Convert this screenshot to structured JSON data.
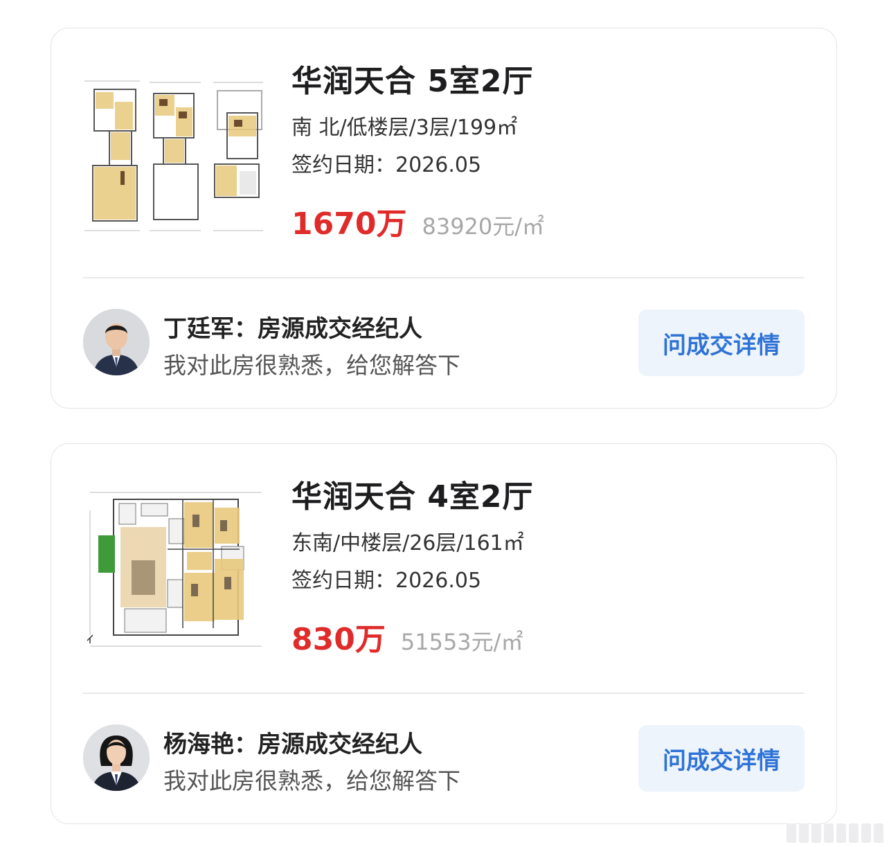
{
  "listings": [
    {
      "title": "华润天合 5室2厅",
      "meta": "南 北/低楼层/3层/199㎡",
      "sign_date": "签约日期：2026.05",
      "price": "1670万",
      "unit_price": "83920元/㎡",
      "agent": {
        "name": "丁廷军：房源成交经纪人",
        "desc": "我对此房很熟悉，给您解答下",
        "button": "问成交详情"
      }
    },
    {
      "title": "华润天合 4室2厅",
      "meta": "东南/中楼层/26层/161㎡",
      "sign_date": "签约日期：2026.05",
      "price": "830万",
      "unit_price": "51553元/㎡",
      "agent": {
        "name": "杨海艳：房源成交经纪人",
        "desc": "我对此房很熟悉，给您解答下",
        "button": "问成交详情"
      }
    }
  ],
  "colors": {
    "price": "#e02b2b",
    "button_text": "#2f73d6",
    "button_bg": "#eef4fc"
  }
}
